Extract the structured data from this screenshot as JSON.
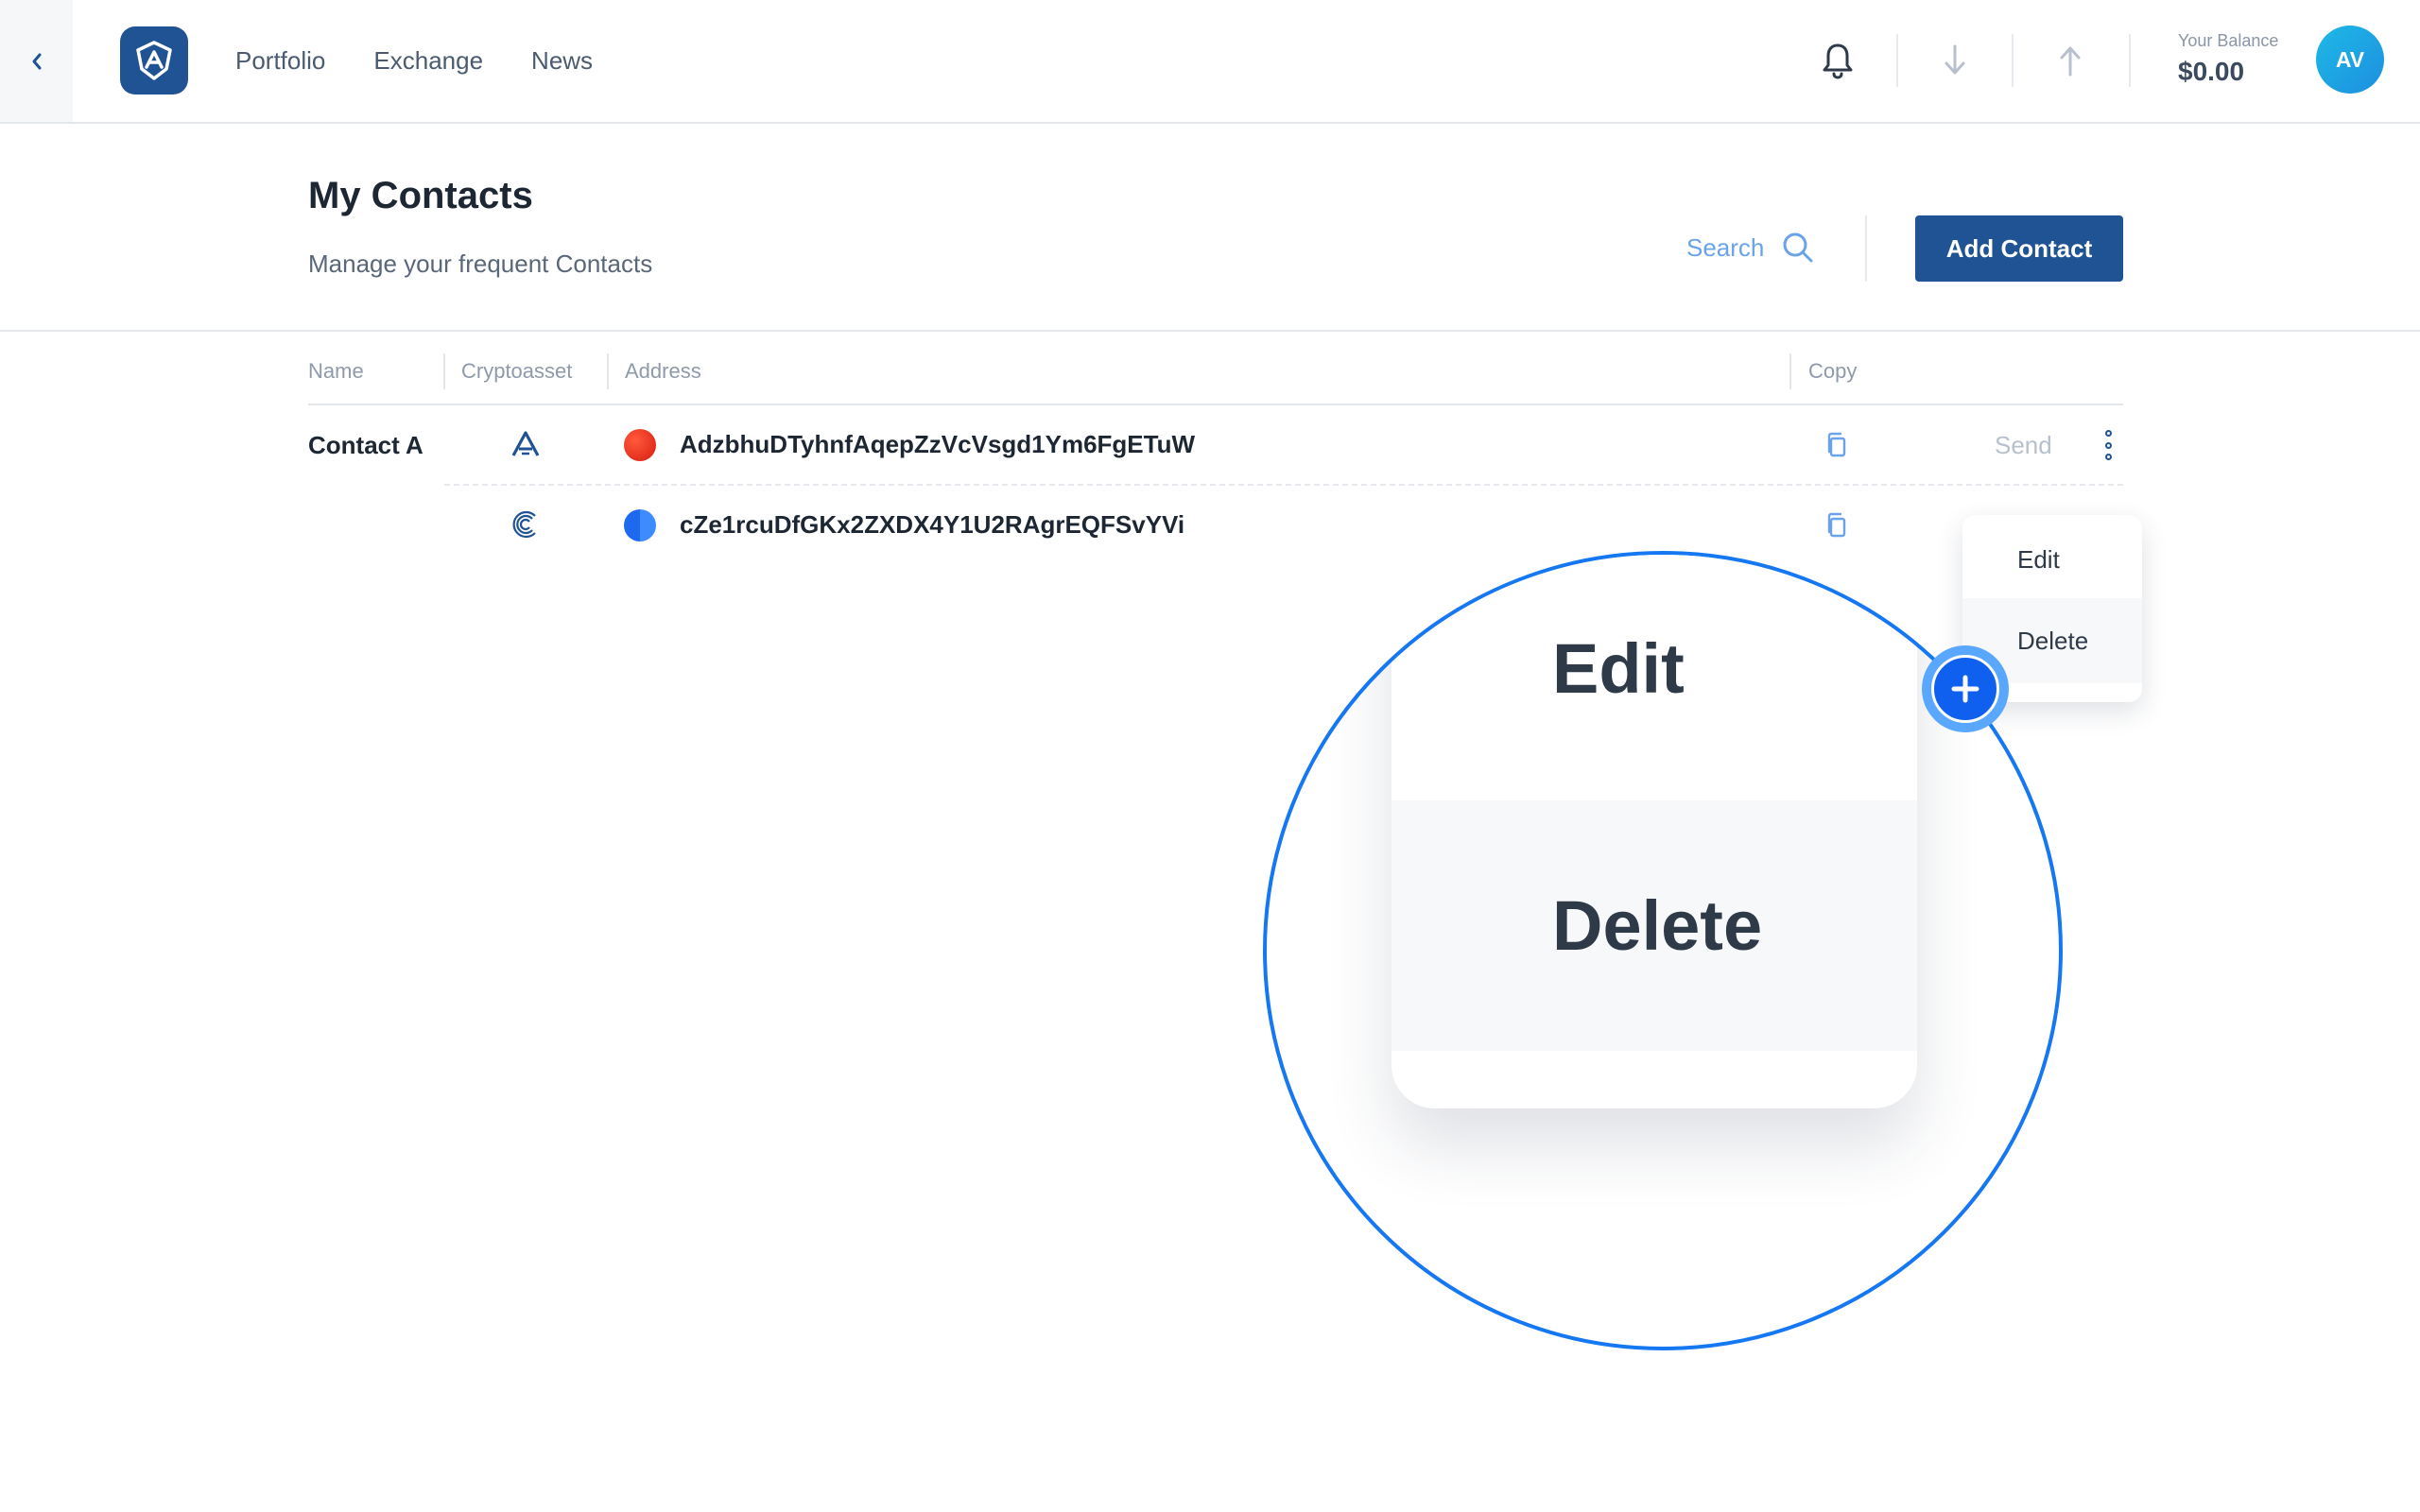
{
  "nav": {
    "items": [
      "Portfolio",
      "Exchange",
      "News"
    ]
  },
  "balance": {
    "label": "Your Balance",
    "value": "$0.00"
  },
  "user": {
    "initials": "AV"
  },
  "page": {
    "title": "My Contacts",
    "subtitle": "Manage your frequent Contacts"
  },
  "search": {
    "label": "Search"
  },
  "add_contact": {
    "label": "Add Contact"
  },
  "table": {
    "headers": [
      "Name",
      "Cryptoasset",
      "Address",
      "Copy"
    ],
    "contact": {
      "name": "Contact A",
      "send_label": "Send",
      "rows": [
        {
          "asset_icon": "ark-icon",
          "coin_color": "#e8291c",
          "address": "AdzbhuDTyhnfAqepZzVcVsgd1Ym6FgETuW"
        },
        {
          "asset_icon": "c-coin-icon",
          "coin_color": "#1d6af0",
          "address": "cZe1rcuDfGKx2ZXDX4Y1U2RAgrEQFSvYVi"
        }
      ]
    }
  },
  "menu": {
    "edit": "Edit",
    "delete": "Delete"
  },
  "zoom": {
    "edit": "Edit",
    "delete": "Delete"
  },
  "colors": {
    "brand": "#1f5393",
    "accent": "#1578f2",
    "search": "#6aa3e8"
  }
}
